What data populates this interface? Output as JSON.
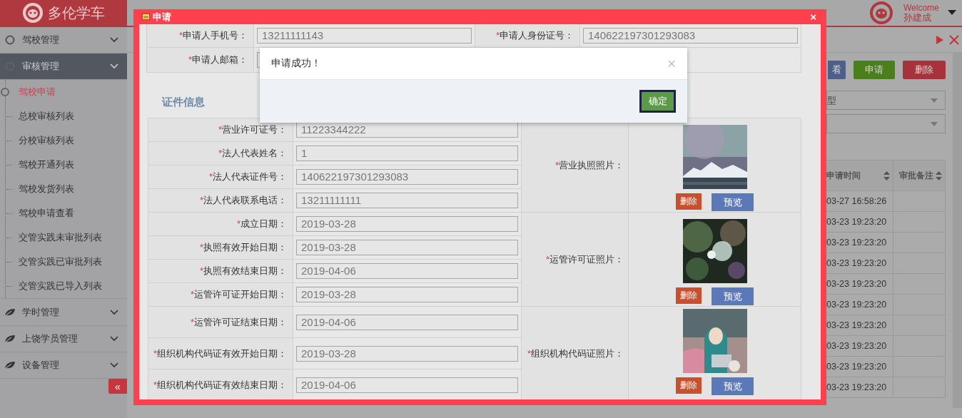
{
  "header": {
    "logo_text": "多伦学车",
    "welcome": "Welcome",
    "user": "孙建成"
  },
  "sidebar": {
    "groups": [
      {
        "label": "驾校管理",
        "kind": "circle",
        "selected": false
      },
      {
        "label": "审核管理",
        "kind": "circle",
        "selected": true,
        "children": [
          {
            "label": "驾校申请",
            "selected": true
          },
          {
            "label": "总校审核列表",
            "selected": false
          },
          {
            "label": "分校审核列表",
            "selected": false
          },
          {
            "label": "驾校开通列表",
            "selected": false
          },
          {
            "label": "驾校发货列表",
            "selected": false
          },
          {
            "label": "驾校申请查看",
            "selected": false
          },
          {
            "label": "交管实践未审批列表",
            "selected": false
          },
          {
            "label": "交管实践已审批列表",
            "selected": false
          },
          {
            "label": "交管实践已导入列表",
            "selected": false
          }
        ]
      },
      {
        "label": "学时管理",
        "kind": "leaf",
        "selected": false
      },
      {
        "label": "上饶学员管理",
        "kind": "leaf",
        "selected": false
      },
      {
        "label": "设备管理",
        "kind": "leaf",
        "selected": false
      }
    ],
    "collapse": "«"
  },
  "toolbar": [
    {
      "label": "看",
      "kind": "view"
    },
    {
      "label": "申请",
      "kind": "apply"
    },
    {
      "label": "删除",
      "kind": "delete"
    }
  ],
  "filters": [
    "型"
  ],
  "table": {
    "columns": [
      "申请时间",
      "审批备注"
    ],
    "rows": [
      {
        "time": "03-27 16:58:26"
      },
      {
        "time": "03-23 19:23:20"
      },
      {
        "time": "03-23 19:23:20"
      },
      {
        "time": "03-23 19:23:20"
      },
      {
        "time": "03-23 19:23:20"
      },
      {
        "time": "03-23 19:23:20"
      },
      {
        "time": "03-23 19:23:20"
      },
      {
        "time": "03-23 19:23:20"
      },
      {
        "time": "03-23 19:23:20"
      },
      {
        "time": "03-23 19:23:20"
      }
    ]
  },
  "dialog": {
    "title": "申请",
    "close": "×",
    "applicant": [
      {
        "mark": "*",
        "label": "申请人手机号：",
        "value": "13211111143"
      },
      {
        "mark": "*",
        "label": "申请人身份证号：",
        "value": "140622197301293083"
      },
      {
        "mark": "*",
        "label": "申请人邮箱："
      }
    ],
    "section": "证件信息",
    "fields": [
      {
        "mark": "*",
        "label": "营业许可证号：",
        "value": "11223344222"
      },
      {
        "mark": "*",
        "label": "法人代表姓名：",
        "value": "1"
      },
      {
        "mark": "*",
        "label": "法人代表证件号：",
        "value": "140622197301293083"
      },
      {
        "mark": "*",
        "label": "法人代表联系电话：",
        "value": "13211111111"
      },
      {
        "mark": "*",
        "label": "成立日期：",
        "value": "2019-03-28"
      },
      {
        "mark": "*",
        "label": "执照有效开始日期：",
        "value": "2019-03-28"
      },
      {
        "mark": "*",
        "label": "执照有效结束日期：",
        "value": "2019-04-06"
      },
      {
        "mark": "*",
        "label": "运管许可证开始日期：",
        "value": "2019-03-28"
      },
      {
        "mark": "*",
        "label": "运管许可证结束日期：",
        "value": "2019-04-06"
      },
      {
        "mark": "*",
        "label": "组织机构代码证有效开始日期：",
        "value": "2019-03-28"
      },
      {
        "mark": "*",
        "label": "组织机构代码证有效结束日期：",
        "value": "2019-04-06"
      }
    ],
    "photos": [
      {
        "mark": "*",
        "label": "营业执照照片：",
        "delete": "删除",
        "preview": "预览",
        "kind": "mountain"
      },
      {
        "mark": "*",
        "label": "运管许可证照片：",
        "delete": "删除",
        "preview": "预览",
        "kind": "bokeh"
      },
      {
        "mark": "*",
        "label": "组织机构代码证照片：",
        "delete": "删除",
        "preview": "预览",
        "kind": "figure"
      }
    ]
  },
  "alert": {
    "message": "申请成功！",
    "close": "×",
    "ok": "确定"
  }
}
